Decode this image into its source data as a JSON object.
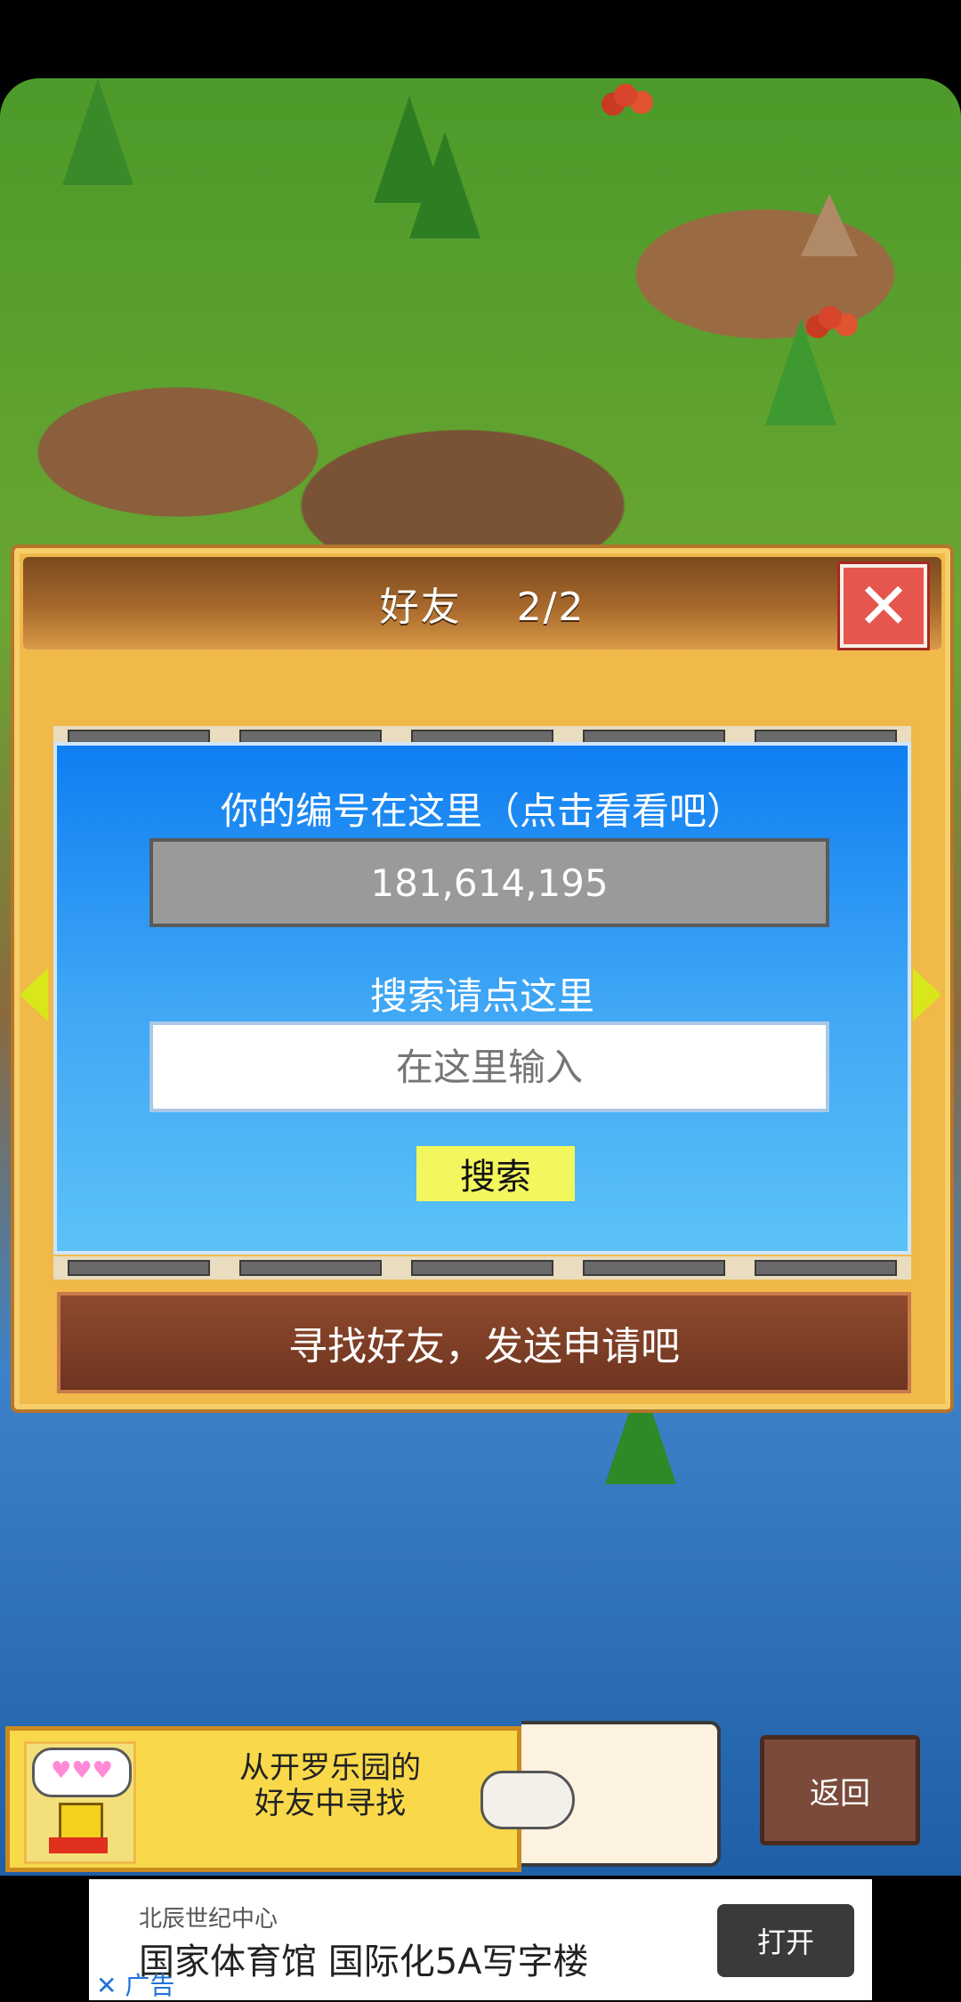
{
  "dialog": {
    "title": "好友　 2/2",
    "close_icon": "close-x-icon",
    "id_label": "你的编号在这里（点击看看吧）",
    "id_value": "181,614,195",
    "search_label": "搜索请点这里",
    "search_placeholder": "在这里输入",
    "search_button": "搜索",
    "friend_button": "寻找好友，发送申请吧"
  },
  "kairo": {
    "bubble": "♥♥♥",
    "text_line1": "从开罗乐园的",
    "text_line2": "好友中寻找"
  },
  "back_button": "返回",
  "ad": {
    "subtitle": "北辰世纪中心",
    "title": "国家体育馆 国际化5A写字楼",
    "tag": "✕ 广告",
    "open_button": "打开"
  }
}
